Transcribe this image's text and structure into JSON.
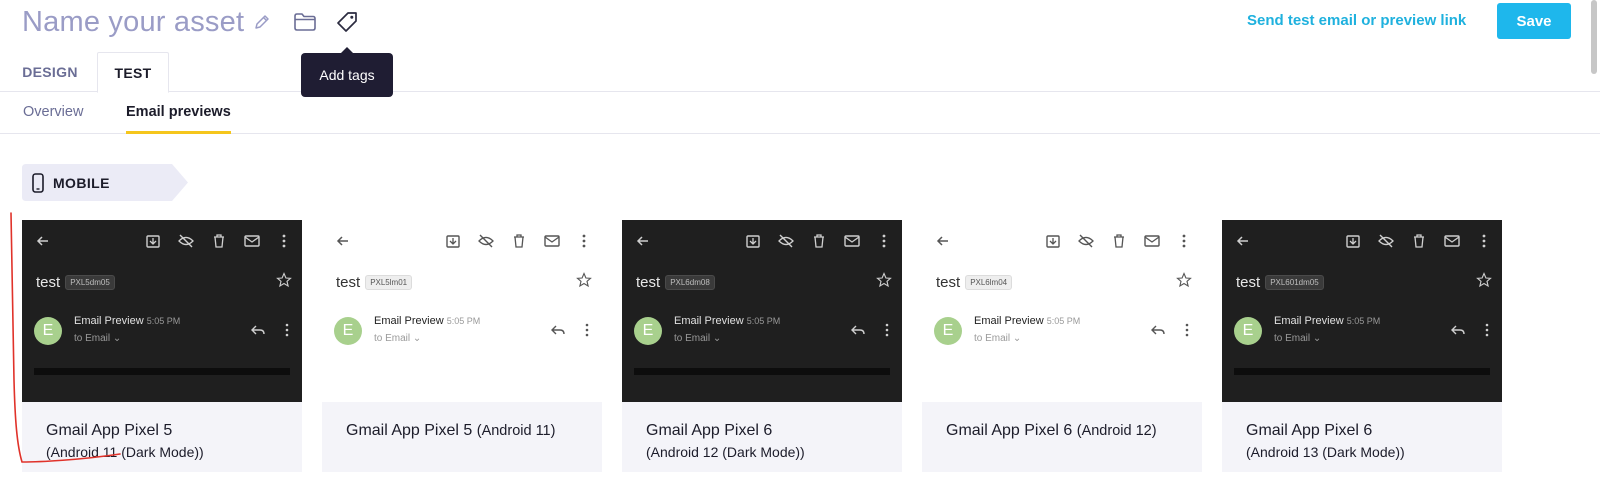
{
  "header": {
    "asset_name_placeholder": "Name your asset",
    "icons": [
      "pencil-icon",
      "folder-icon",
      "tag-icon"
    ],
    "send_test_link": "Send test email or preview link",
    "save_label": "Save",
    "tooltip": "Add tags"
  },
  "tabs": [
    {
      "label": "DESIGN",
      "active": false
    },
    {
      "label": "TEST",
      "active": true
    }
  ],
  "sub_tabs": [
    {
      "label": "Overview",
      "active": false
    },
    {
      "label": "Email previews",
      "active": true
    }
  ],
  "section": {
    "label": "MOBILE",
    "icon": "phone-icon"
  },
  "preview_common": {
    "subject": "test",
    "sender": "Email Preview",
    "time": "5:05 PM",
    "to_line": "to Email",
    "avatar_letter": "E"
  },
  "cards": [
    {
      "title": "Gmail App Pixel 5",
      "title_suffix": "",
      "subtitle": "(Android 11 (Dark Mode))",
      "theme": "dark",
      "code": "PXL5dm05"
    },
    {
      "title": "Gmail App Pixel 5",
      "title_suffix": "(Android 11)",
      "subtitle": "",
      "theme": "light",
      "code": "PXL5lm01"
    },
    {
      "title": "Gmail App Pixel 6",
      "title_suffix": "",
      "subtitle": "(Android 12 (Dark Mode))",
      "theme": "dark",
      "code": "PXL6dm08"
    },
    {
      "title": "Gmail App Pixel 6",
      "title_suffix": "(Android 12)",
      "subtitle": "",
      "theme": "light",
      "code": "PXL6lm04"
    },
    {
      "title": "Gmail App Pixel 6",
      "title_suffix": "",
      "subtitle": "(Android 13 (Dark Mode))",
      "theme": "dark",
      "code": "PXL601dm05"
    }
  ],
  "colors": {
    "accent": "#1eb7ec",
    "link": "#1fb1de",
    "tab_underline": "#f5c61d",
    "placeholder": "#9a9cc6",
    "annotation_red": "#e0322a"
  }
}
